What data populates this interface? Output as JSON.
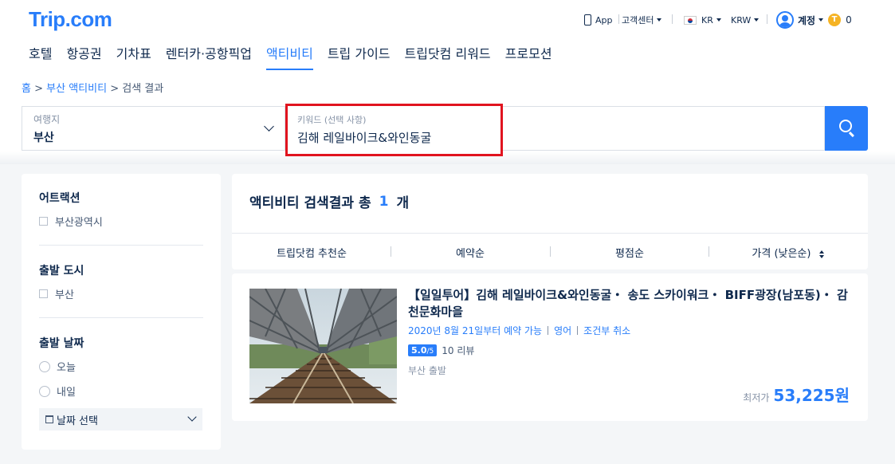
{
  "brand": {
    "logo": "Trip.com"
  },
  "utility": {
    "app": "App",
    "support": "고객센터",
    "language": "KR",
    "currency": "KRW",
    "account": "계정",
    "points": "0",
    "coin_icon_letter": "T"
  },
  "nav": {
    "items": [
      "호텔",
      "항공권",
      "기차표",
      "렌터카·공항픽업",
      "액티비티",
      "트립 가이드",
      "트립닷컴 리워드",
      "프로모션"
    ],
    "active_index": 4
  },
  "breadcrumb": {
    "home": "홈",
    "sep": ">",
    "parent": "부산 액티비티",
    "current": "검색 결과"
  },
  "search": {
    "destination_label": "여행지",
    "destination_value": "부산",
    "keyword_label": "키워드 (선택 사항)",
    "keyword_value": "김해 레일바이크&와인동굴"
  },
  "filters": {
    "attraction": {
      "title": "어트랙션",
      "options": [
        "부산광역시"
      ]
    },
    "departure_city": {
      "title": "출발 도시",
      "options": [
        "부산"
      ]
    },
    "departure_date": {
      "title": "출발 날짜",
      "options": [
        "오늘",
        "내일"
      ],
      "picker_label": "날짜 선택"
    }
  },
  "results": {
    "prefix": "액티비티 검색결과 총",
    "count": "1",
    "suffix": "개",
    "sort_options": [
      "트립닷컴 추천순",
      "예약순",
      "평점순",
      "가격 (낮은순)"
    ]
  },
  "product": {
    "title": "【일일투어】김해 레일바이크&와인동굴・ 송도 스카이워크・ BIFF광장(남포동)・ 감천문화마을",
    "meta": [
      "2020년 8월 21일부터 예약 가능",
      "영어",
      "조건부 취소"
    ],
    "rating": "5.0",
    "rating_max": "/5",
    "reviews": "10 리뷰",
    "departure": "부산 출발",
    "price_label": "최저가",
    "price": "53,225원"
  },
  "colors": {
    "accent": "#287dfa",
    "text": "#0f294d",
    "highlight": "#e1141f"
  }
}
